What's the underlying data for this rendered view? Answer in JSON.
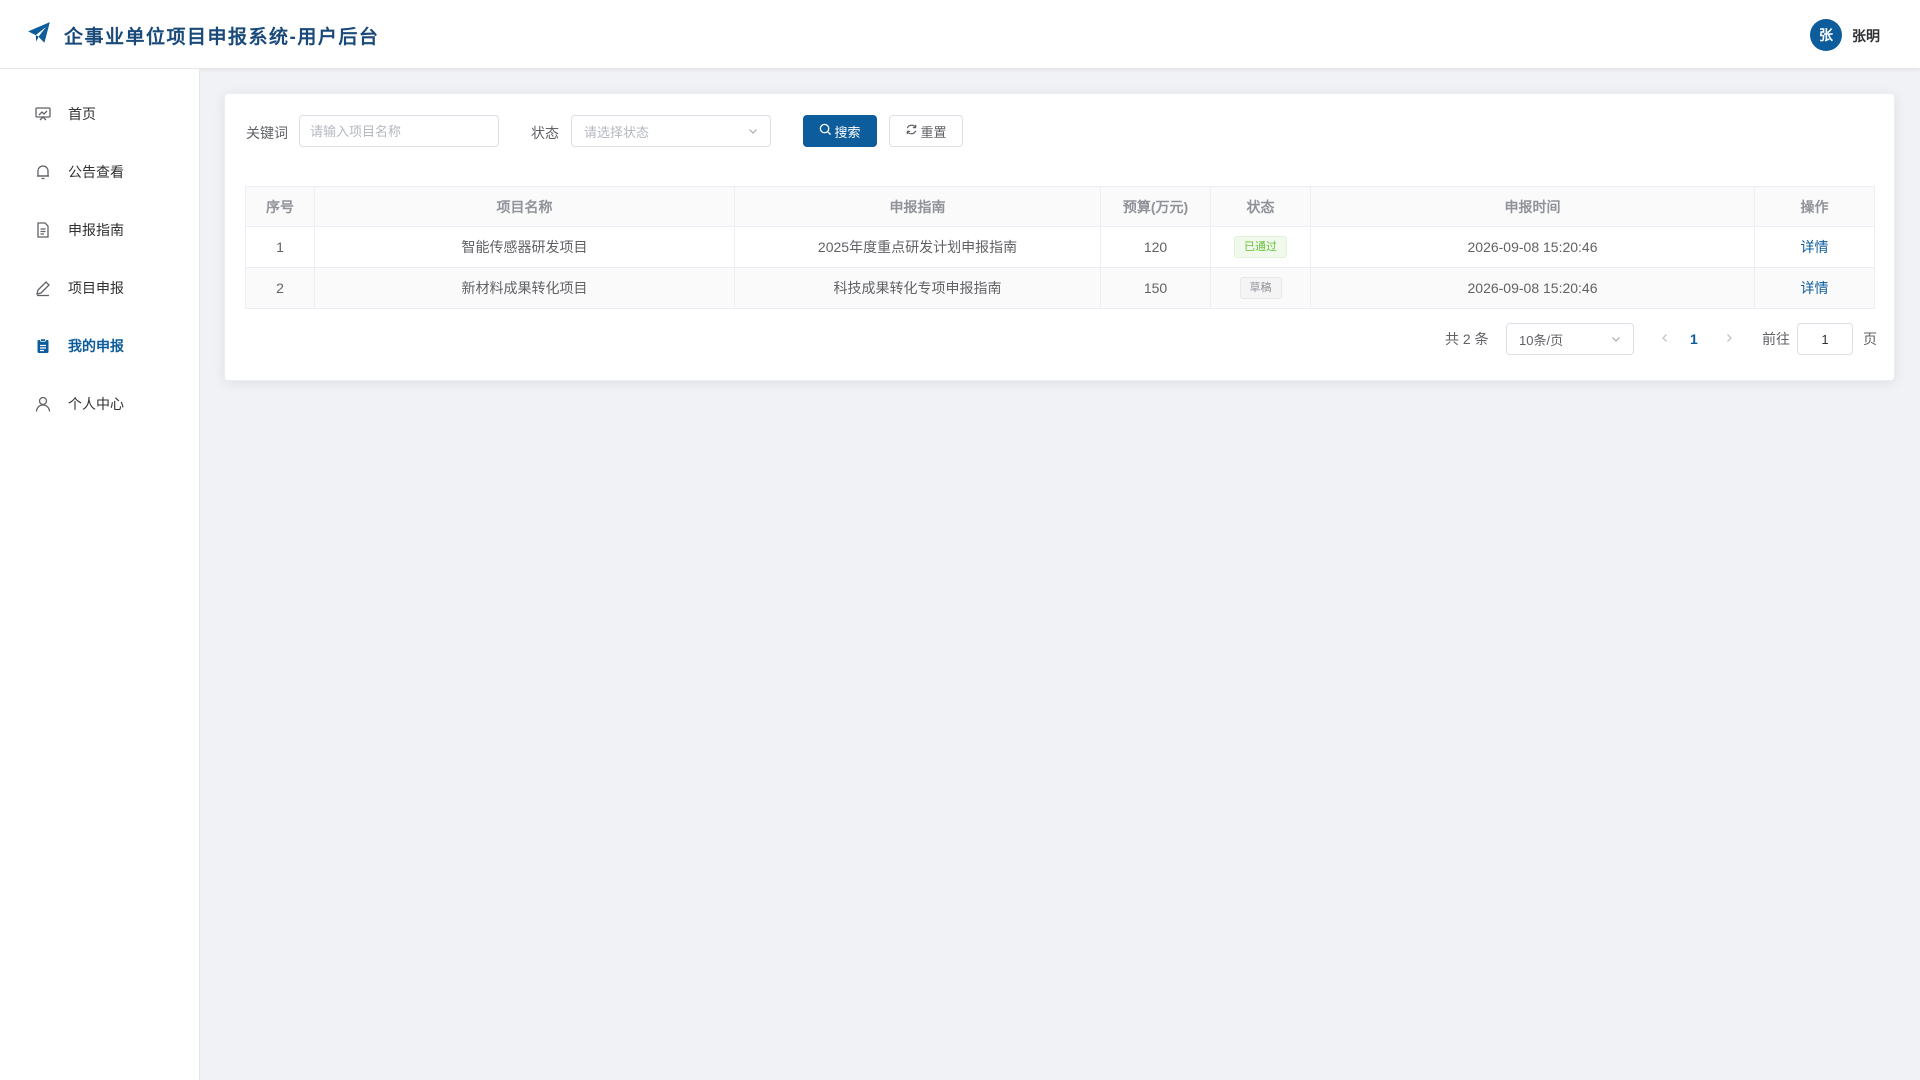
{
  "header": {
    "title": "企事业单位项目申报系统-用户后台",
    "avatar_text": "张",
    "username": "张明",
    "logo_icon": "paper-plane-icon",
    "brand_color": "#0d5c9c"
  },
  "sidebar": {
    "items": [
      {
        "label": "首页",
        "icon": "dashboard-icon",
        "active": false
      },
      {
        "label": "公告查看",
        "icon": "bell-icon",
        "active": false
      },
      {
        "label": "申报指南",
        "icon": "document-icon",
        "active": false
      },
      {
        "label": "项目申报",
        "icon": "edit-icon",
        "active": false
      },
      {
        "label": "我的申报",
        "icon": "clipboard-icon",
        "active": true
      },
      {
        "label": "个人中心",
        "icon": "user-icon",
        "active": false
      }
    ]
  },
  "filters": {
    "keyword_label": "关键词",
    "keyword_placeholder": "请输入项目名称",
    "keyword_value": "",
    "status_label": "状态",
    "status_placeholder": "请选择状态",
    "search_label": "搜索",
    "reset_label": "重置"
  },
  "table": {
    "columns": [
      "序号",
      "项目名称",
      "申报指南",
      "预算(万元)",
      "状态",
      "申报时间",
      "操作"
    ],
    "rows": [
      {
        "index": "1",
        "name": "智能传感器研发项目",
        "guide": "2025年度重点研发计划申报指南",
        "budget": "120",
        "status": "已通过",
        "status_type": "success",
        "time": "2026-09-08 15:20:46",
        "action": "详情"
      },
      {
        "index": "2",
        "name": "新材料成果转化项目",
        "guide": "科技成果转化专项申报指南",
        "budget": "150",
        "status": "草稿",
        "status_type": "info",
        "time": "2026-09-08 15:20:46",
        "action": "详情"
      }
    ]
  },
  "pagination": {
    "total_text": "共 2 条",
    "page_size": "10条/页",
    "current_page": "1",
    "goto_label": "前往",
    "goto_value": "1",
    "page_unit": "页"
  }
}
